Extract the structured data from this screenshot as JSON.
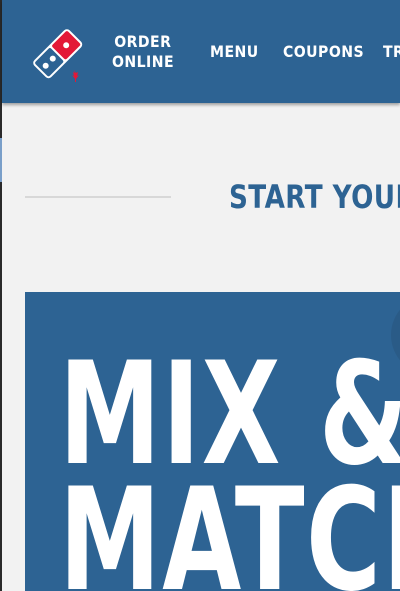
{
  "header": {
    "logo_name": "dominos-logo",
    "order_online": [
      "ORDER",
      "ONLINE"
    ],
    "nav": [
      "MENU",
      "COUPONS",
      "TR"
    ]
  },
  "section": {
    "heading": "START YOUR"
  },
  "promo": {
    "lines": [
      "MIX &",
      "MATCH"
    ]
  },
  "colors": {
    "brand_blue": "#2d6393",
    "brand_red": "#e31837",
    "background": "#f2f2f2"
  }
}
